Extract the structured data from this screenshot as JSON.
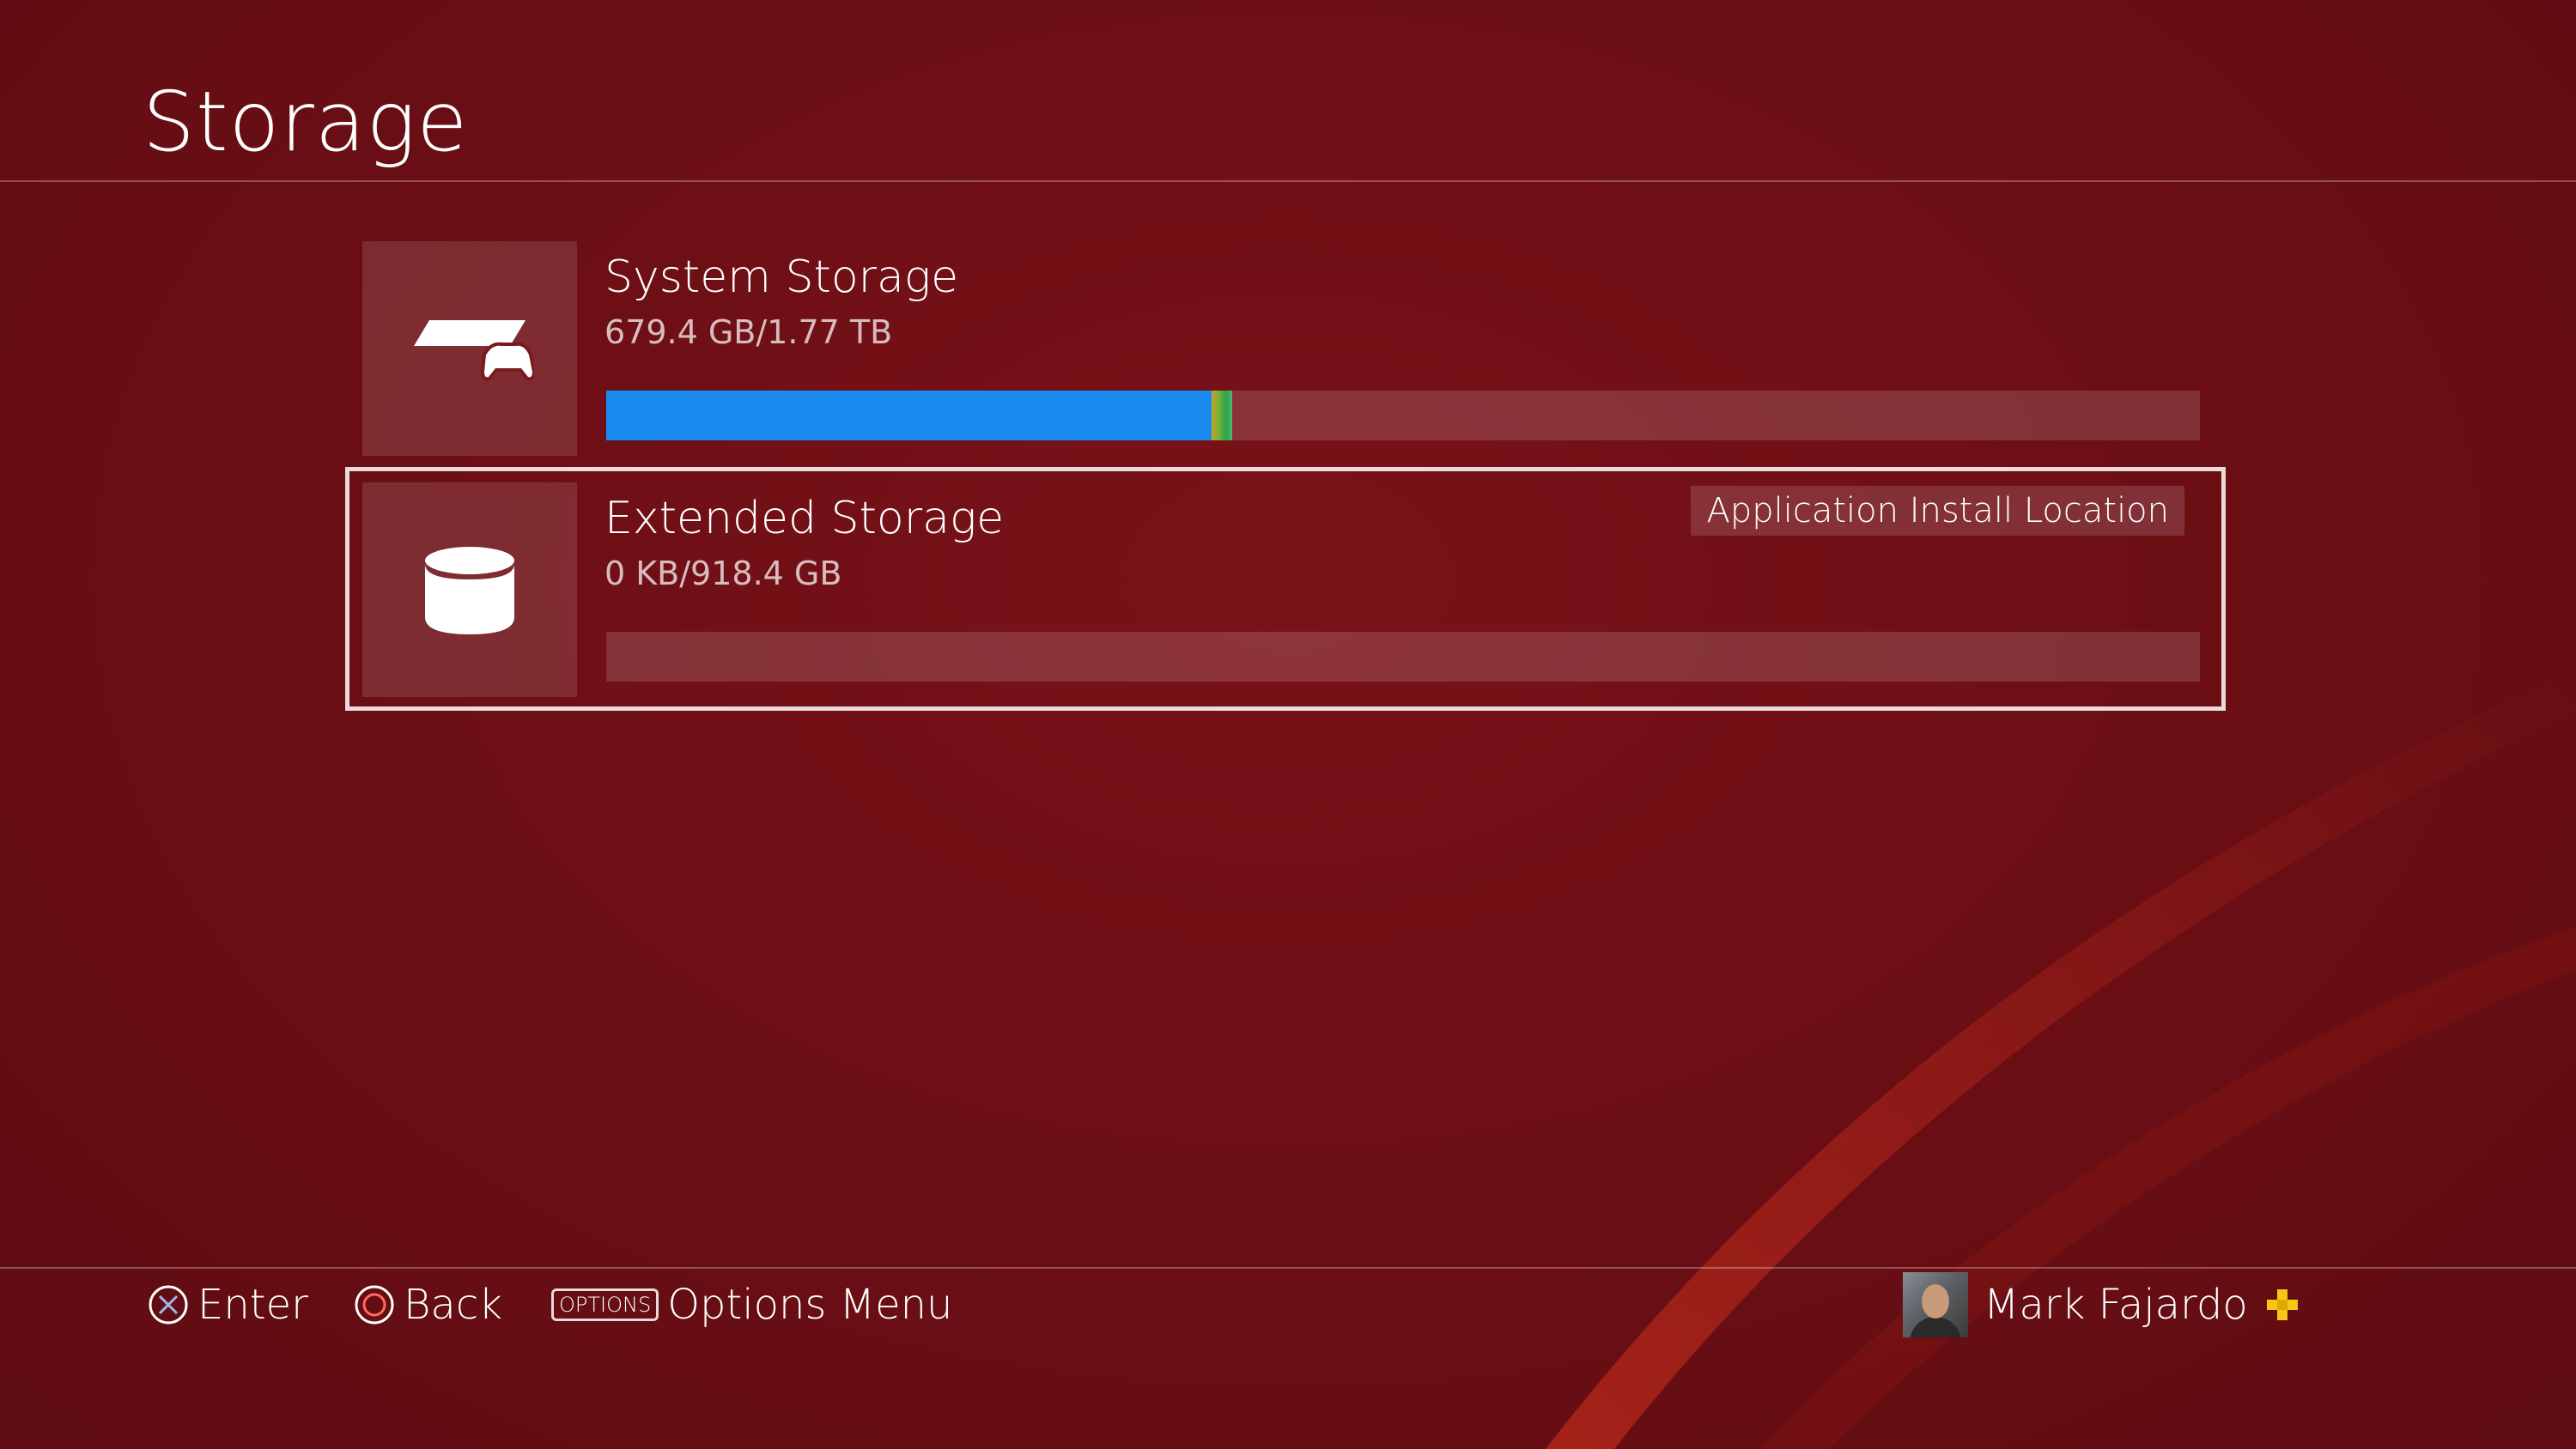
{
  "header": {
    "title": "Storage"
  },
  "storage": [
    {
      "name": "System Storage",
      "usage_text": "679.4 GB/1.77 TB",
      "usage_fraction": 0.38,
      "icon": "ps4-console-icon"
    },
    {
      "name": "Extended Storage",
      "usage_text": "0 KB/918.4 GB",
      "usage_fraction": 0,
      "badge": "Application Install Location",
      "icon": "external-drive-icon"
    }
  ],
  "footer": {
    "enter_label": "Enter",
    "back_label": "Back",
    "options_key": "OPTIONS",
    "options_label": "Options Menu",
    "user_name": "Mark Fajardo"
  },
  "colors": {
    "background": "#6d0f15",
    "usage_fill": "#1a8cf0",
    "plus_badge": "#f5c518"
  }
}
